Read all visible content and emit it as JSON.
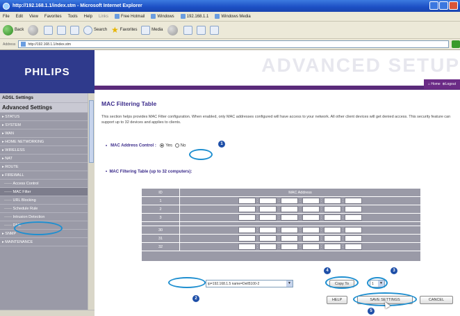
{
  "window": {
    "title": "http://192.168.1.1/index.stm - Microsoft Internet Explorer"
  },
  "menu": {
    "items": [
      "File",
      "Edit",
      "View",
      "Favorites",
      "Tools",
      "Help"
    ],
    "links_label": "Links",
    "links": [
      "Free Hotmail",
      "Windows",
      "192.168.1.1",
      "Windows Media"
    ]
  },
  "toolbar": {
    "back": "Back",
    "search": "Search",
    "favorites": "Favorites",
    "media": "Media"
  },
  "address": {
    "label": "Address",
    "value": "http://192.168.1.1/index.stm"
  },
  "brand": {
    "logo": "PHILIPS",
    "banner": "ADVANCED SETUP",
    "home": "Home",
    "logout": "Logout"
  },
  "sidebar": {
    "adsl": "ADSL Settings",
    "advanced": "Advanced Settings",
    "items": [
      "STATUS",
      "SYSTEM",
      "WAN",
      "HOME NETWORKING",
      "WIRELESS",
      "NAT",
      "ROUTE",
      "FIREWALL"
    ],
    "firewall_sub": [
      "Access Control",
      "MAC Filter",
      "URL Blocking",
      "Schedule Rule",
      "Intrusion Detection",
      "DMZ"
    ],
    "bottom": [
      "SNMP",
      "MAINTENANCE"
    ]
  },
  "page": {
    "title": "MAC Filtering Table",
    "description": "This section helps provides MAC Filter configuration. When enabled, only MAC addresses configured will have access to your network. All other client devices will get denied access. This security feature can support up to 32 devices and applies to clients.",
    "control_label": "MAC Address Control :",
    "yes": "Yes",
    "no": "No",
    "table_label": "MAC Filtering Table (up to 32 computers):"
  },
  "table": {
    "headers": [
      "ID",
      "MAC Address"
    ],
    "ids_top": [
      "1",
      "2",
      "3"
    ],
    "ids_bottom": [
      "30",
      "31",
      "32"
    ],
    "separator": ":"
  },
  "dhcp": {
    "label": "DHCP Client List:",
    "value": "ip=192.168.1.5 name=Dell5100-2",
    "copy": "Copy To",
    "slot": "1"
  },
  "buttons": {
    "help": "HELP",
    "save": "SAVE SETTINGS",
    "cancel": "CANCEL"
  },
  "callouts": [
    "1",
    "2",
    "3",
    "4",
    "5"
  ],
  "colors": {
    "accent": "#3a2a8a",
    "sidebar": "#9a9aa7",
    "callout": "#1e4fa8",
    "ring": "#1f8fd0"
  }
}
